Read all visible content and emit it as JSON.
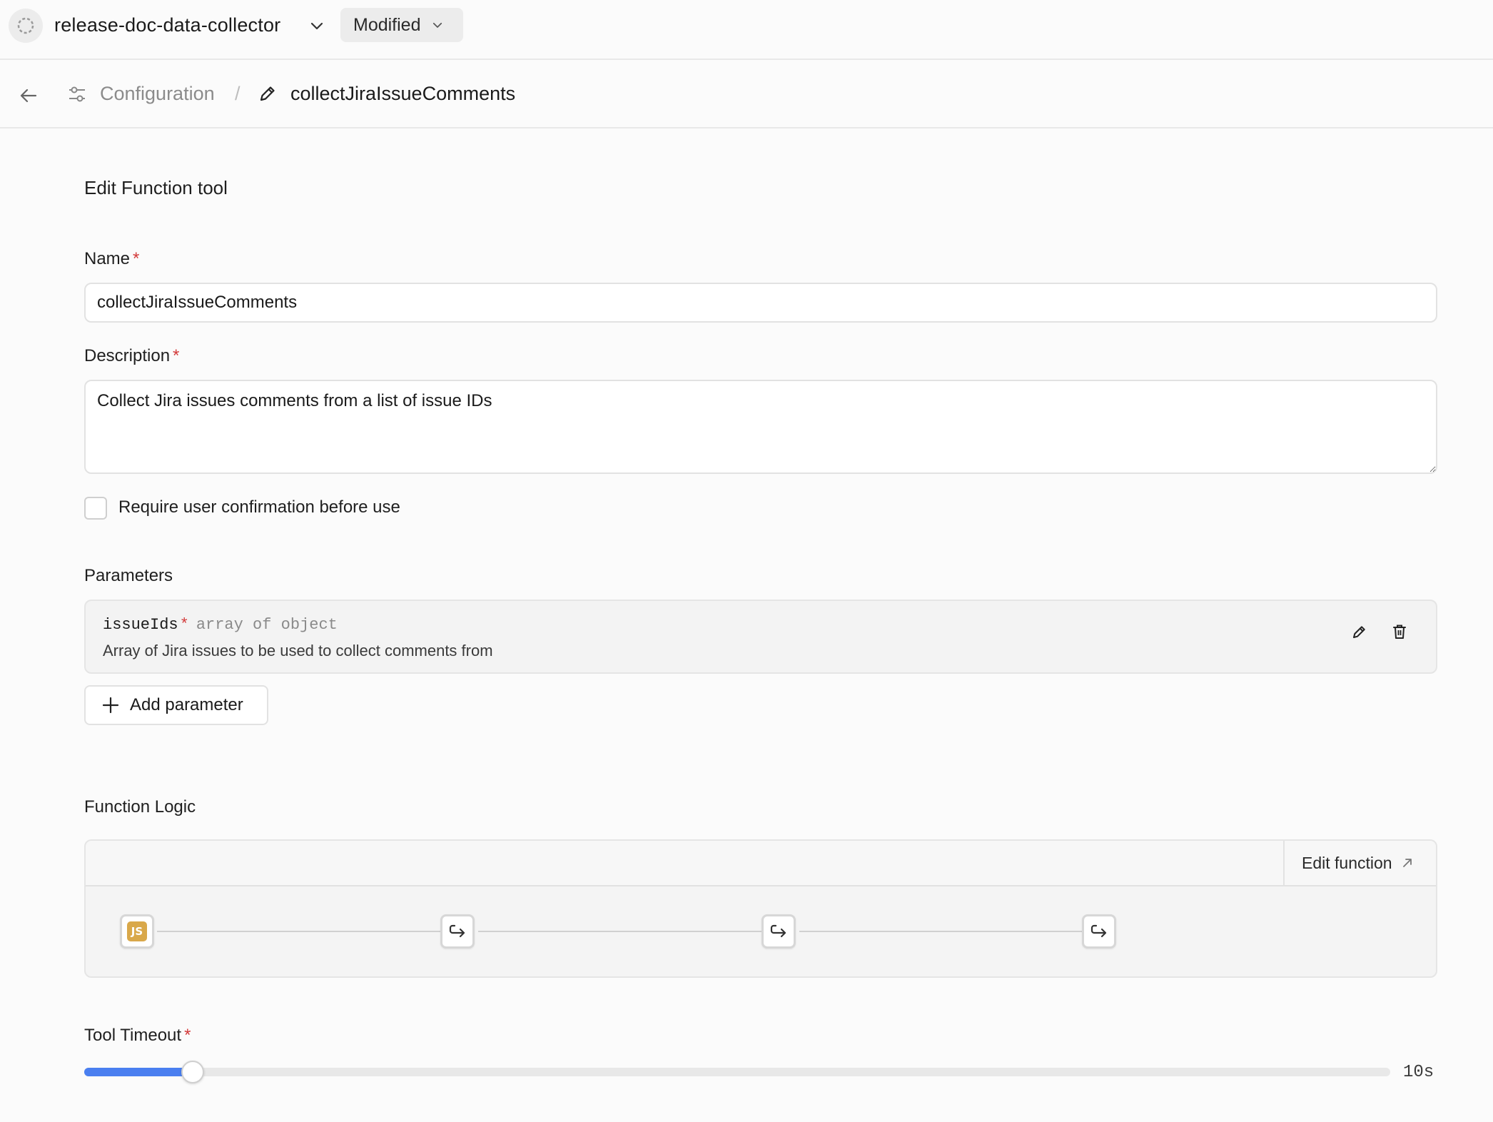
{
  "header": {
    "app_name": "release-doc-data-collector",
    "status": "Modified"
  },
  "breadcrumb": {
    "parent": "Configuration",
    "separator": "/",
    "current": "collectJiraIssueComments"
  },
  "form": {
    "title": "Edit Function tool",
    "name_label": "Name",
    "name_value": "collectJiraIssueComments",
    "description_label": "Description",
    "description_value": "Collect Jira issues comments from a list of issue IDs",
    "required_marker": "*",
    "confirm_label": "Require user confirmation before use",
    "confirm_checked": false
  },
  "parameters": {
    "title": "Parameters",
    "items": [
      {
        "name": "issueIds",
        "required": "*",
        "type": "array of object",
        "description": "Array of Jira issues to be used to collect comments from"
      }
    ],
    "add_label": "Add parameter"
  },
  "function_logic": {
    "title": "Function Logic",
    "edit_label": "Edit function",
    "js_badge": "JS",
    "nodes": [
      "js-node",
      "return-node",
      "return-node",
      "return-node"
    ]
  },
  "timeout": {
    "label": "Tool Timeout",
    "value_label": "10s",
    "fill_fraction": 0.083
  },
  "colors": {
    "accent": "#4a7ff0",
    "required": "#d33a3a",
    "js_badge": "#d9a84a"
  }
}
